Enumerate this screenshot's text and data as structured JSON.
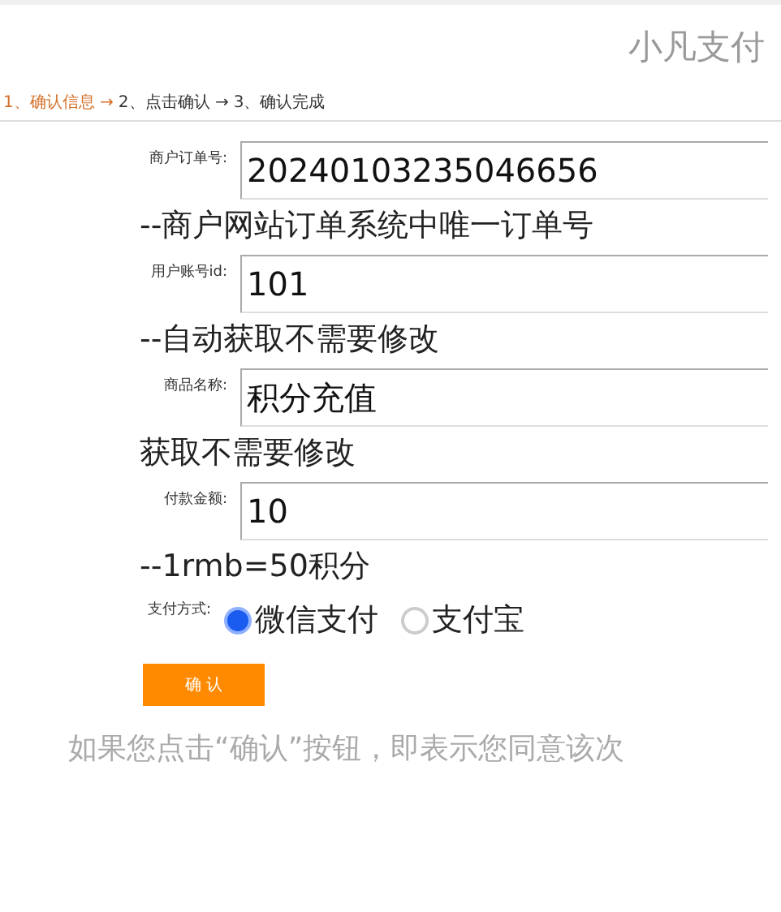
{
  "header": {
    "title": "小凡支付"
  },
  "steps": [
    {
      "label": "1、确认信息 →",
      "selected": true
    },
    {
      "label": "2、点击确认 →",
      "selected": false
    },
    {
      "label": "3、确认完成",
      "selected": false
    }
  ],
  "fields": [
    {
      "label": "商户订单号:",
      "value": "20240103235046656",
      "hint": "--商户网站订单系统中唯一订单号"
    },
    {
      "label": "用户账号id:",
      "value": "101",
      "hint": "--自动获取不需要修改"
    },
    {
      "label": "商品名称:",
      "value": "积分充值",
      "hint": "获取不需要修改"
    },
    {
      "label": "付款金额:",
      "value": "10",
      "hint": "--1rmb=50积分"
    }
  ],
  "payment": {
    "label": "支付方式:",
    "options": [
      {
        "label": "微信支付",
        "selected": true
      },
      {
        "label": "支付宝",
        "selected": false
      }
    ]
  },
  "confirm_button": "确 认",
  "notice": "如果您点击“确认”按钮，即表示您同意该次"
}
